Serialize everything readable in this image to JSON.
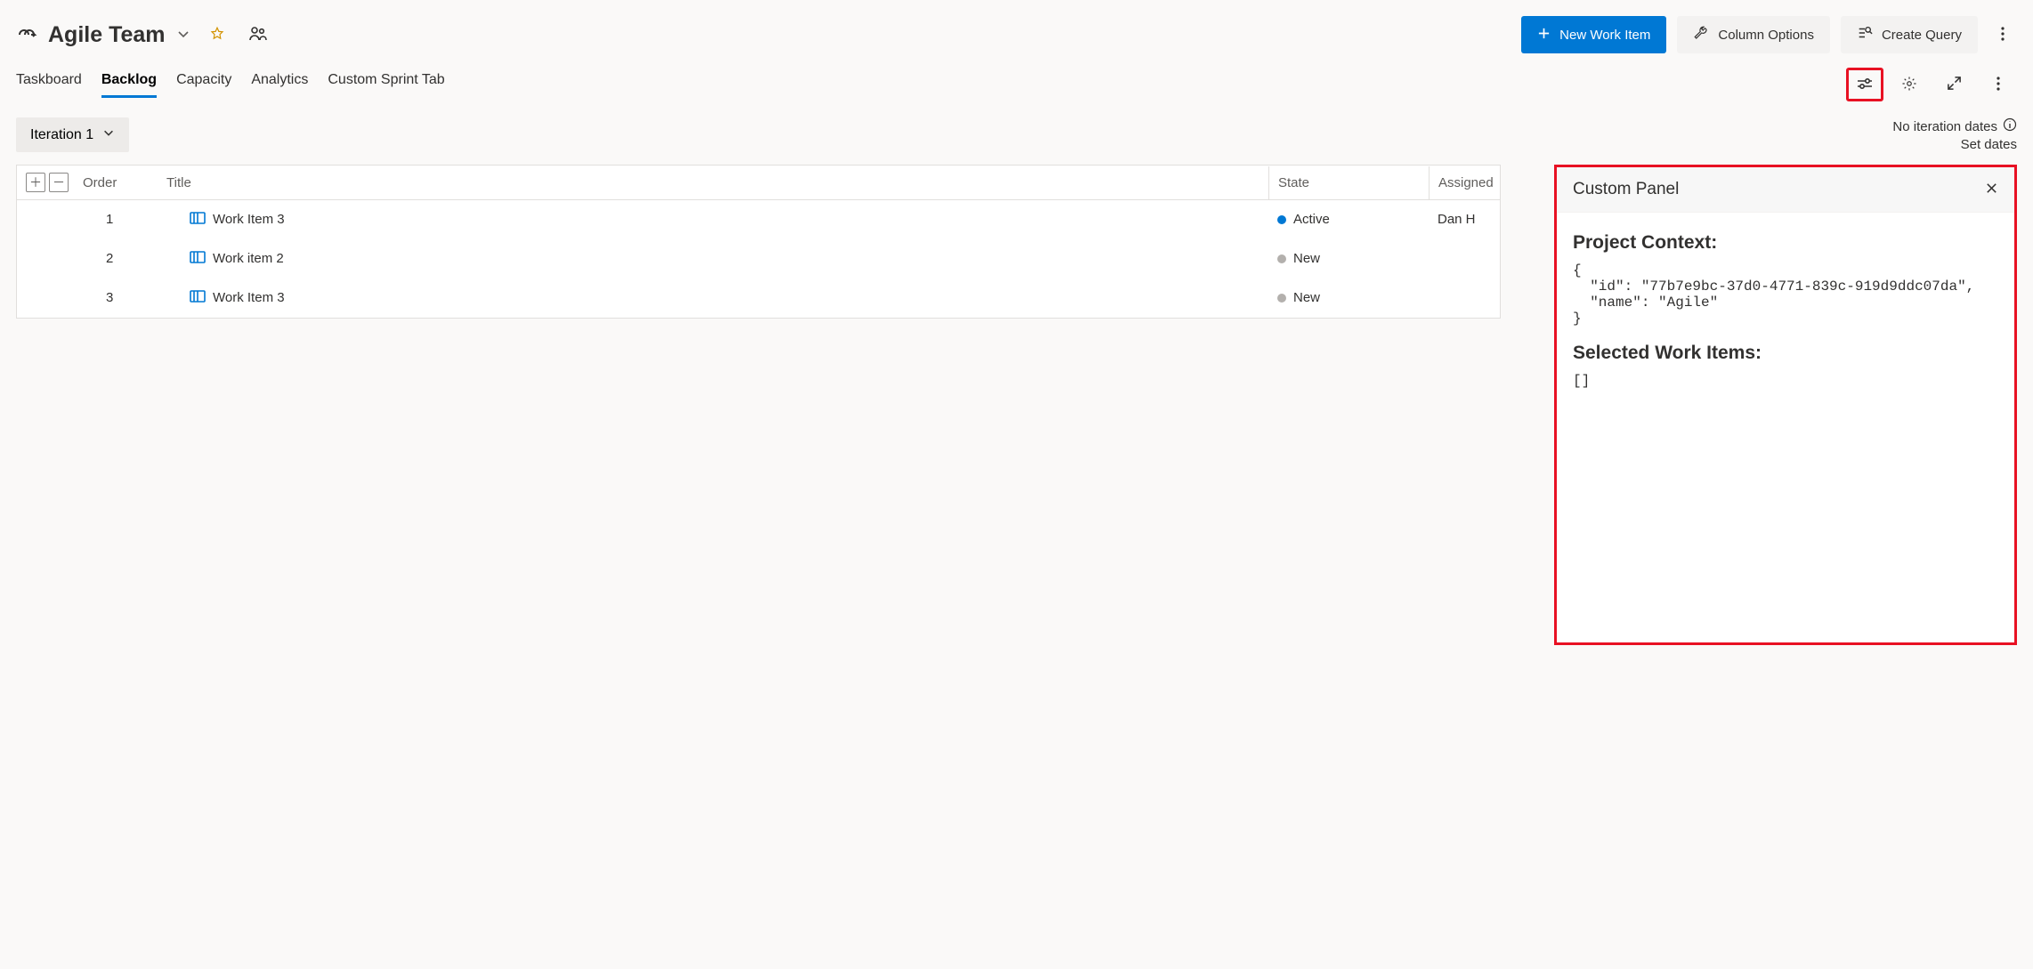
{
  "header": {
    "team_name": "Agile Team",
    "new_work_item": "New Work Item",
    "column_options": "Column Options",
    "create_query": "Create Query"
  },
  "tabs": {
    "taskboard": "Taskboard",
    "backlog": "Backlog",
    "capacity": "Capacity",
    "analytics": "Analytics",
    "custom": "Custom Sprint Tab",
    "active": "backlog"
  },
  "iteration": {
    "label": "Iteration 1",
    "no_dates": "No iteration dates",
    "set_dates": "Set dates"
  },
  "grid": {
    "columns": {
      "order": "Order",
      "title": "Title",
      "state": "State",
      "assigned": "Assigned"
    },
    "rows": [
      {
        "order": "1",
        "title": "Work Item 3",
        "state": "Active",
        "state_kind": "active",
        "assigned": "Dan H"
      },
      {
        "order": "2",
        "title": "Work item 2",
        "state": "New",
        "state_kind": "new",
        "assigned": ""
      },
      {
        "order": "3",
        "title": "Work Item 3",
        "state": "New",
        "state_kind": "new",
        "assigned": ""
      }
    ]
  },
  "panel": {
    "title": "Custom Panel",
    "ctx_heading": "Project Context:",
    "ctx_json": "{\n  \"id\": \"77b7e9bc-37d0-4771-839c-919d9ddc07da\",\n  \"name\": \"Agile\"\n}",
    "sel_heading": "Selected Work Items:",
    "sel_json": "[]"
  }
}
